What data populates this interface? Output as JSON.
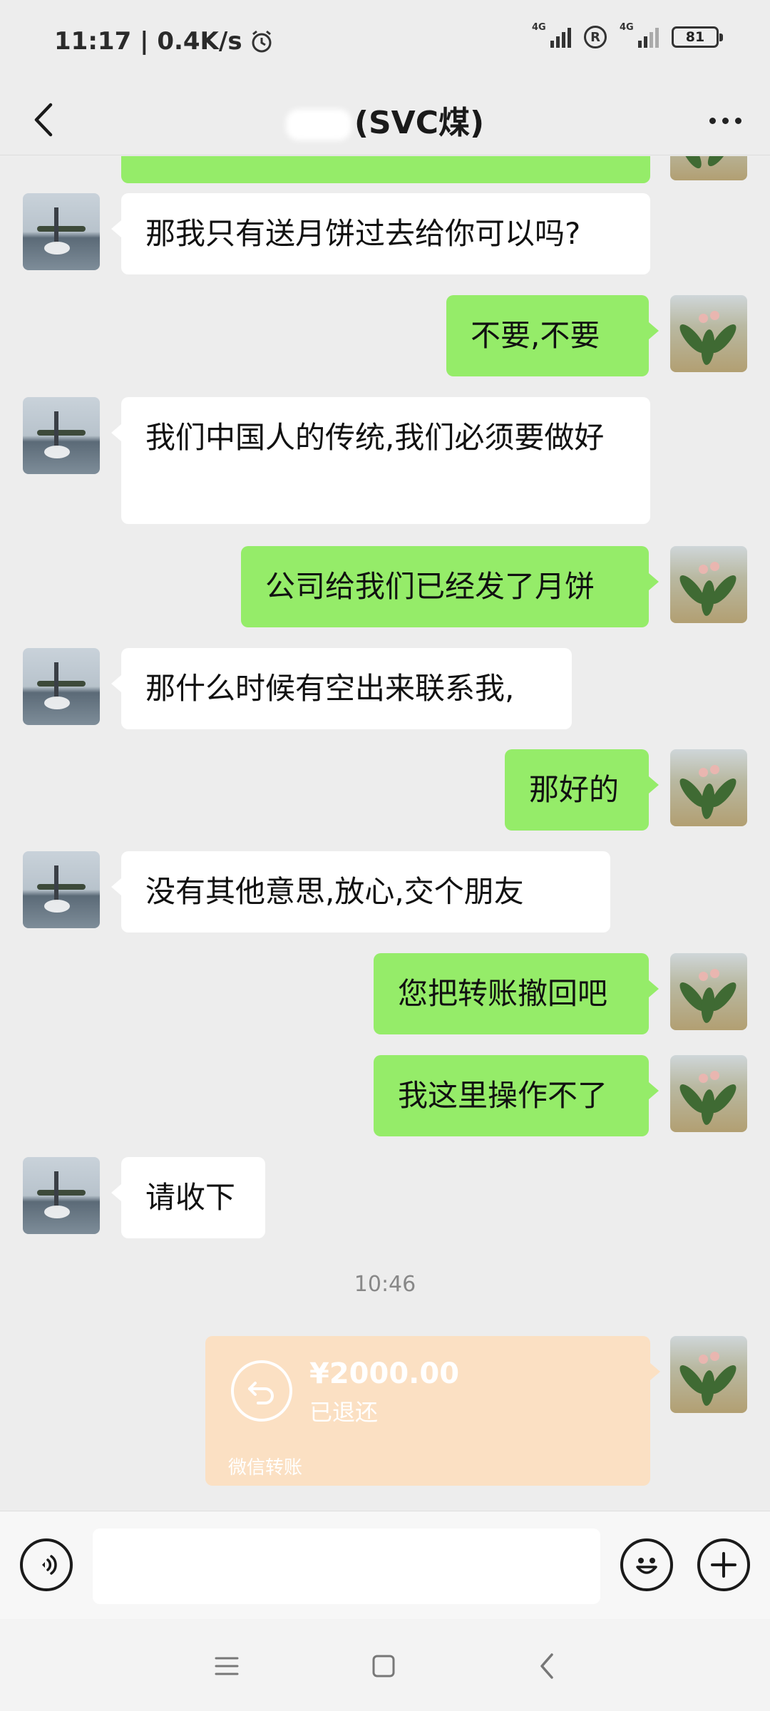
{
  "status_bar": {
    "time": "11:17 | 0.4K/s",
    "network_1": "4G",
    "network_2": "4G",
    "roaming": "R",
    "battery": "81"
  },
  "header": {
    "title": "(SVC煤)",
    "icons": {
      "back": "chevron-left-icon",
      "more": "more-dots-icon"
    }
  },
  "messages": [
    {
      "side": "in",
      "text": "那我只有送月饼过去给你可以吗?"
    },
    {
      "side": "out",
      "text": "不要,不要"
    },
    {
      "side": "in",
      "text": "我们中国人的传统,我们必须要做好"
    },
    {
      "side": "out",
      "text": "公司给我们已经发了月饼"
    },
    {
      "side": "in",
      "text": "那什么时候有空出来联系我,"
    },
    {
      "side": "out",
      "text": "那好的"
    },
    {
      "side": "in",
      "text": "没有其他意思,放心,交个朋友"
    },
    {
      "side": "out",
      "text": "您把转账撤回吧"
    },
    {
      "side": "out",
      "text": "我这里操作不了"
    },
    {
      "side": "in",
      "text": "请收下"
    }
  ],
  "time_divider": "10:46",
  "transfer": {
    "amount": "¥2000.00",
    "status": "已退还",
    "label": "微信转账",
    "card_color": "#fbe0c3"
  },
  "input_bar": {
    "placeholder": "",
    "icons": {
      "voice": "voice-icon",
      "emoji": "smiley-icon",
      "plus": "plus-icon"
    }
  },
  "colors": {
    "background": "#ededed",
    "outgoing_bubble": "#95ec69",
    "incoming_bubble": "#ffffff"
  }
}
